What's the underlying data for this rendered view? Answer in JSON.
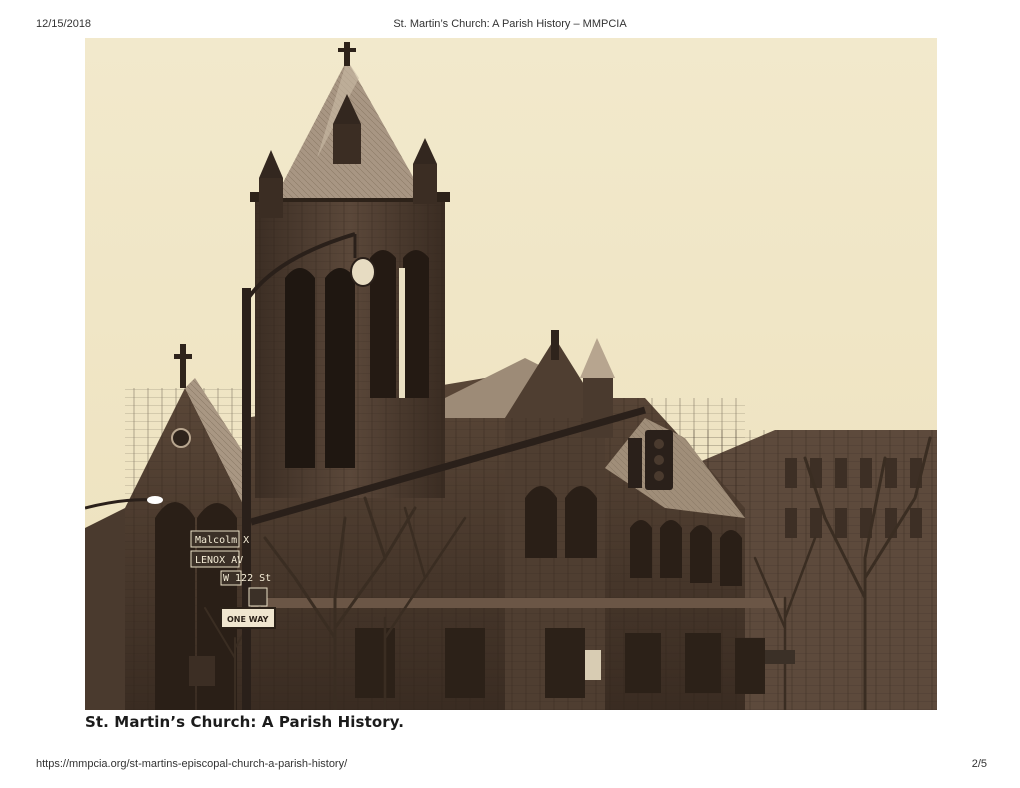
{
  "print_header": {
    "date": "12/15/2018",
    "title": "St. Martin’s Church: A Parish History – MMPCIA"
  },
  "photo": {
    "street_signs": {
      "malcolm": "Malcolm X",
      "lenox": "LENOX AV",
      "w122": "W 122 St",
      "one_way": "ONE WAY"
    }
  },
  "caption": "St. Martin’s Church: A Parish History.",
  "print_footer": {
    "url": "https://mmpcia.org/st-martins-episcopal-church-a-parish-history/",
    "page": "2/5"
  }
}
